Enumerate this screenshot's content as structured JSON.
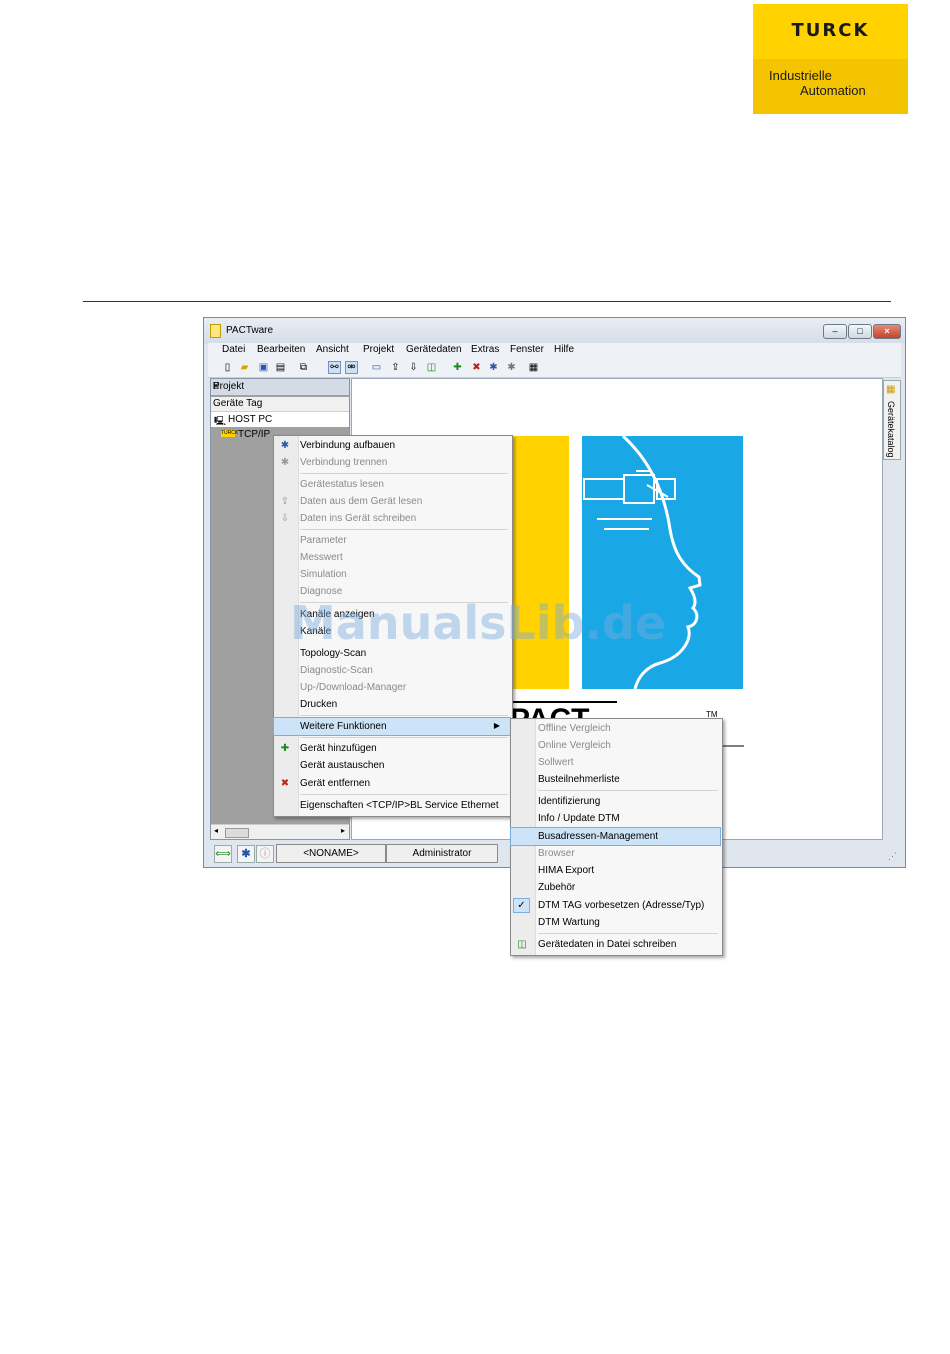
{
  "logo": {
    "brand": "TURCK",
    "line1": "Industrielle",
    "line2": "Automation"
  },
  "window": {
    "title": "PACTware",
    "menu": [
      "Datei",
      "Bearbeiten",
      "Ansicht",
      "Projekt",
      "Gerätedaten",
      "Extras",
      "Fenster",
      "Hilfe"
    ]
  },
  "project_panel": {
    "title": "Projekt",
    "pin": "⌹",
    "close": "×",
    "column": "Geräte Tag",
    "items": [
      {
        "label": "HOST PC",
        "icon": "computer-icon"
      },
      {
        "label": "TCP/IP",
        "icon": "turck-device-icon"
      }
    ]
  },
  "side_tab": {
    "label": "Gerätekatalog"
  },
  "status_bar": {
    "project": "<NONAME>",
    "user": "Administrator"
  },
  "context_menu": {
    "items": [
      {
        "label": "Verbindung aufbauen",
        "enabled": true,
        "icon": "connect-icon"
      },
      {
        "label": "Verbindung trennen",
        "enabled": false,
        "icon": "disconnect-icon"
      },
      {
        "label": "Gerätestatus lesen",
        "enabled": false
      },
      {
        "label": "Daten aus dem Gerät lesen",
        "enabled": false,
        "icon": "upload-icon"
      },
      {
        "label": "Daten ins Gerät schreiben",
        "enabled": false,
        "icon": "download-icon"
      },
      {
        "label": "Parameter",
        "enabled": false
      },
      {
        "label": "Messwert",
        "enabled": false
      },
      {
        "label": "Simulation",
        "enabled": false
      },
      {
        "label": "Diagnose",
        "enabled": false
      },
      {
        "label": "Kanäle anzeigen",
        "enabled": true
      },
      {
        "label": "Kanäle",
        "enabled": true
      },
      {
        "label": "Topology-Scan",
        "enabled": true
      },
      {
        "label": "Diagnostic-Scan",
        "enabled": false
      },
      {
        "label": "Up-/Download-Manager",
        "enabled": false
      },
      {
        "label": "Drucken",
        "enabled": true
      },
      {
        "label": "Weitere Funktionen",
        "enabled": true,
        "highlighted": true
      },
      {
        "label": "Gerät hinzufügen",
        "enabled": true,
        "icon": "add-device-icon"
      },
      {
        "label": "Gerät austauschen",
        "enabled": true
      },
      {
        "label": "Gerät entfernen",
        "enabled": true,
        "icon": "remove-device-icon"
      },
      {
        "label": "Eigenschaften <TCP/IP>BL Service Ethernet",
        "enabled": true
      }
    ]
  },
  "submenu": {
    "items": [
      {
        "label": "Offline Vergleich",
        "enabled": false
      },
      {
        "label": "Online Vergleich",
        "enabled": false
      },
      {
        "label": "Sollwert",
        "enabled": false
      },
      {
        "label": "Busteilnehmerliste",
        "enabled": true
      },
      {
        "label": "Identifizierung",
        "enabled": true
      },
      {
        "label": "Info / Update DTM",
        "enabled": true
      },
      {
        "label": "Busadressen-Management",
        "enabled": true,
        "highlighted": true
      },
      {
        "label": "Browser",
        "enabled": false
      },
      {
        "label": "HIMA Export",
        "enabled": true
      },
      {
        "label": "Zubehör",
        "enabled": true
      },
      {
        "label": "DTM TAG vorbesetzen (Adresse/Typ)",
        "enabled": true,
        "checked": true
      },
      {
        "label": "DTM Wartung",
        "enabled": true
      },
      {
        "label": "Gerätedaten in Datei schreiben",
        "enabled": true,
        "icon": "write-file-icon"
      }
    ]
  },
  "splash": {
    "text": "PACT",
    "trademark": "TM"
  },
  "watermark": "ManualsLib.de",
  "colors": {
    "turck_yellow": "#ffd200",
    "splash_blue": "#1aa7e6",
    "highlight": "#cde3f7"
  }
}
